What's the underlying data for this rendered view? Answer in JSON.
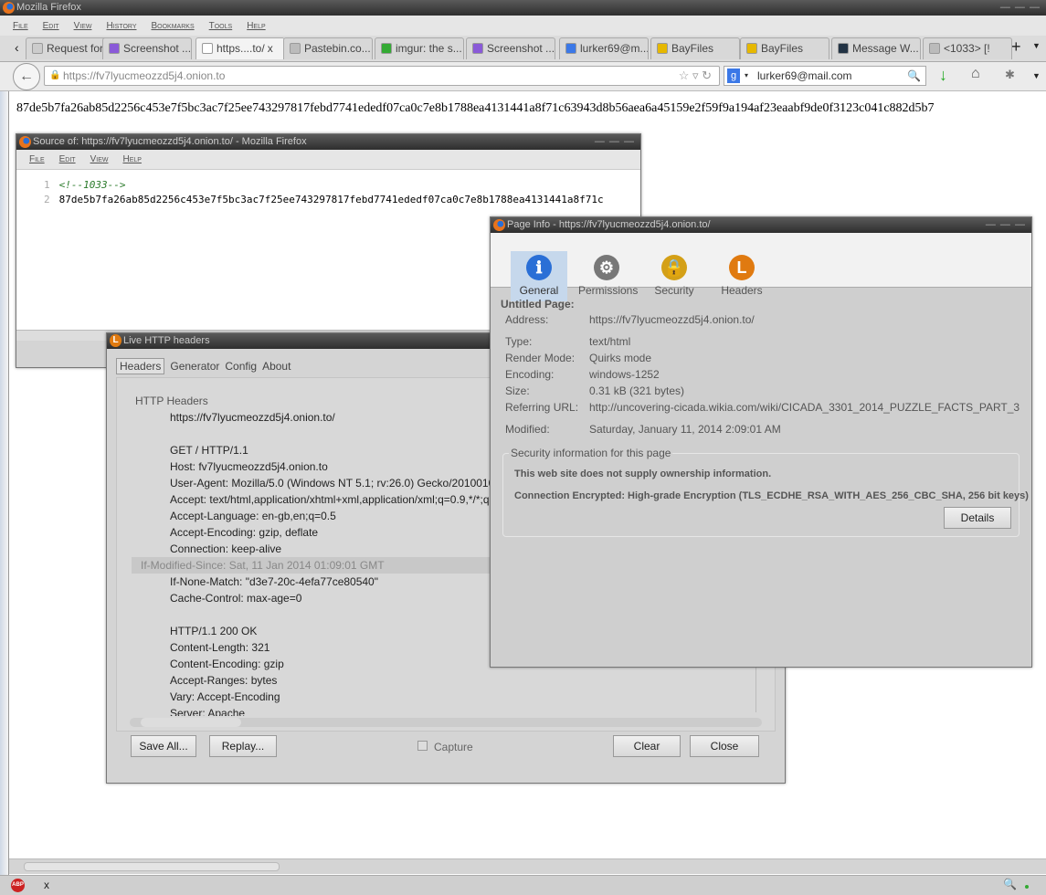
{
  "browser": {
    "title": "Mozilla Firefox",
    "menu": [
      "File",
      "Edit",
      "View",
      "History",
      "Bookmarks",
      "Tools",
      "Help"
    ],
    "tabs": [
      {
        "label": "Request for..."
      },
      {
        "label": "Screenshot ..."
      },
      {
        "label": "https....to/",
        "active": true
      },
      {
        "label": "Pastebin.co..."
      },
      {
        "label": "imgur: the s..."
      },
      {
        "label": "Screenshot ..."
      },
      {
        "label": "lurker69@m..."
      },
      {
        "label": "BayFiles"
      },
      {
        "label": "BayFiles"
      },
      {
        "label": "Message W..."
      },
      {
        "label": "<1033> [!"
      }
    ],
    "url": "https://fv7lyucmeozzd5j4.onion.to",
    "search_value": "lurker69@mail.com",
    "page_text": "87de5b7fa26ab85d2256c453e7f5bc3ac7f25ee743297817febd7741ededf07ca0c7e8b1788ea4131441a8f71c63943d8b56aea6a45159e2f59f9a194af23eaabf9de0f3123c041c882d5b7",
    "status_close": "x"
  },
  "source_window": {
    "title": "Source of: https://fv7lyucmeozzd5j4.onion.to/ - Mozilla Firefox",
    "menu": [
      "File",
      "Edit",
      "View",
      "Help"
    ],
    "lines": [
      {
        "num": "1",
        "text": "<!--1033-->"
      },
      {
        "num": "2",
        "text": "87de5b7fa26ab85d2256c453e7f5bc3ac7f25ee743297817febd7741ededf07ca0c7e8b1788ea4131441a8f71c"
      }
    ]
  },
  "live_headers": {
    "title": "Live HTTP headers",
    "tabs": [
      "Headers",
      "Generator",
      "Config",
      "About"
    ],
    "section": "HTTP Headers",
    "lines": [
      "https://fv7lyucmeozzd5j4.onion.to/",
      "",
      "GET / HTTP/1.1",
      "Host: fv7lyucmeozzd5j4.onion.to",
      "User-Agent: Mozilla/5.0 (Windows NT 5.1; rv:26.0) Gecko/20100101 Firefox/26.0",
      "Accept: text/html,application/xhtml+xml,application/xml;q=0.9,*/*;q=0.8",
      "Accept-Language: en-gb,en;q=0.5",
      "Accept-Encoding: gzip, deflate",
      "Connection: keep-alive",
      "If-Modified-Since: Sat, 11 Jan 2014 01:09:01 GMT",
      "If-None-Match: \"d3e7-20c-4efa77ce80540\"",
      "Cache-Control: max-age=0",
      "",
      "HTTP/1.1 200 OK",
      "Content-Length: 321",
      "Content-Encoding: gzip",
      "Accept-Ranges: bytes",
      "Vary: Accept-Encoding",
      "Server: Apache"
    ],
    "buttons": {
      "save_all": "Save All...",
      "replay": "Replay...",
      "capture": "Capture",
      "clear": "Clear",
      "close": "Close"
    },
    "capture_checked": false
  },
  "page_info": {
    "title": "Page Info - https://fv7lyucmeozzd5j4.onion.to/",
    "tabs": [
      "General",
      "Permissions",
      "Security",
      "Headers"
    ],
    "page_title": "Untitled Page:",
    "fields": [
      {
        "label": "Address:",
        "value": "https://fv7lyucmeozzd5j4.onion.to/"
      },
      {
        "label": "Type:",
        "value": "text/html"
      },
      {
        "label": "Render Mode:",
        "value": "Quirks mode"
      },
      {
        "label": "Encoding:",
        "value": "windows-1252"
      },
      {
        "label": "Size:",
        "value": "0.31 kB (321 bytes)"
      },
      {
        "label": "Referring URL:",
        "value": "http://uncovering-cicada.wikia.com/wiki/CICADA_3301_2014_PUZZLE_FACTS_PART_3"
      },
      {
        "label": "Modified:",
        "value": "Saturday, January 11, 2014 2:09:01 AM"
      }
    ],
    "security": {
      "legend": "Security information for this page",
      "ownership": "This web site does not supply ownership information.",
      "encryption": "Connection Encrypted: High-grade Encryption (TLS_ECDHE_RSA_WITH_AES_256_CBC_SHA, 256 bit keys)",
      "details": "Details"
    }
  }
}
